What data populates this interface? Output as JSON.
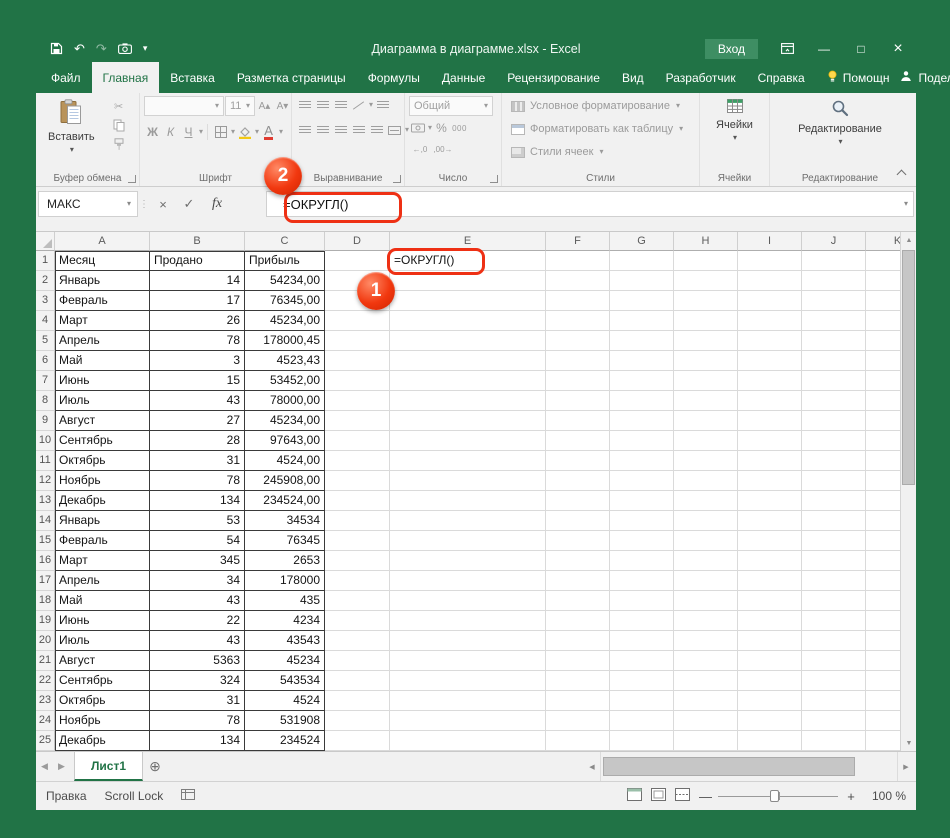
{
  "titlebar": {
    "title": "Диаграмма в диаграмме.xlsx  -  Excel",
    "sign_in": "Вход"
  },
  "icons": {
    "undo": "↶",
    "redo": "↷",
    "dropdown": "▾",
    "minimize": "—",
    "maximize": "□",
    "close": "×",
    "scissors": "✂",
    "check": "✓",
    "cancel": "×",
    "fx": "fx",
    "grip": "⋮",
    "prev_sheet": "◀",
    "next_sheet": "▶",
    "add_sheet": "⊕",
    "up": "▲",
    "down": "▼",
    "left": "◀",
    "right": "▶",
    "percent": "%",
    "thousands": "000",
    "dec_inc": "←,0",
    "dec_dec": ",00→",
    "zoom_out": "—",
    "zoom_in": "+",
    "bold": "Ж",
    "italic": "К",
    "underline": "Ч",
    "grow_font": "А▴",
    "shrink_font": "А▾",
    "font_color_letter": "А"
  },
  "ribbon_tabs": [
    {
      "label": "Файл"
    },
    {
      "label": "Главная",
      "active": true
    },
    {
      "label": "Вставка"
    },
    {
      "label": "Разметка страницы"
    },
    {
      "label": "Формулы"
    },
    {
      "label": "Данные"
    },
    {
      "label": "Рецензирование"
    },
    {
      "label": "Вид"
    },
    {
      "label": "Разработчик"
    },
    {
      "label": "Справка"
    },
    {
      "label": "Помощн",
      "bulb": true
    }
  ],
  "share_label": "Поделиться",
  "ribbon": {
    "paste": "Вставить",
    "font_name": "",
    "font_size": "11",
    "number_format": "Общий",
    "style_buttons": [
      "Условное форматирование",
      "Форматировать как таблицу",
      "Стили ячеек"
    ],
    "cells": "Ячейки",
    "editing": "Редактирование",
    "groups": [
      "Буфер обмена",
      "Шрифт",
      "Выравнивание",
      "Число",
      "Стили",
      "Ячейки",
      "Редактирование"
    ]
  },
  "formula_bar": {
    "name_box": "МАКС",
    "formula": "=ОКРУГЛ()"
  },
  "annotations": {
    "step1": "1",
    "step2": "2",
    "accent": "#ee3014"
  },
  "sheet": {
    "col_headers": [
      "A",
      "B",
      "C",
      "D",
      "E",
      "F",
      "G",
      "H",
      "I",
      "J",
      "K"
    ],
    "e1": "=ОКРУГЛ()",
    "rows": [
      [
        "1",
        "Месяц",
        "Продано",
        "Прибыль"
      ],
      [
        "2",
        "Январь",
        "14",
        "54234,00"
      ],
      [
        "3",
        "Февраль",
        "17",
        "76345,00"
      ],
      [
        "4",
        "Март",
        "26",
        "45234,00"
      ],
      [
        "5",
        "Апрель",
        "78",
        "178000,45"
      ],
      [
        "6",
        "Май",
        "3",
        "4523,43"
      ],
      [
        "7",
        "Июнь",
        "15",
        "53452,00"
      ],
      [
        "8",
        "Июль",
        "43",
        "78000,00"
      ],
      [
        "9",
        "Август",
        "27",
        "45234,00"
      ],
      [
        "10",
        "Сентябрь",
        "28",
        "97643,00"
      ],
      [
        "11",
        "Октябрь",
        "31",
        "4524,00"
      ],
      [
        "12",
        "Ноябрь",
        "78",
        "245908,00"
      ],
      [
        "13",
        "Декабрь",
        "134",
        "234524,00"
      ],
      [
        "14",
        "Январь",
        "53",
        "34534"
      ],
      [
        "15",
        "Февраль",
        "54",
        "76345"
      ],
      [
        "16",
        "Март",
        "345",
        "2653"
      ],
      [
        "17",
        "Апрель",
        "34",
        "178000"
      ],
      [
        "18",
        "Май",
        "43",
        "435"
      ],
      [
        "19",
        "Июнь",
        "22",
        "4234"
      ],
      [
        "20",
        "Июль",
        "43",
        "43543"
      ],
      [
        "21",
        "Август",
        "5363",
        "45234"
      ],
      [
        "22",
        "Сентябрь",
        "324",
        "543534"
      ],
      [
        "23",
        "Октябрь",
        "31",
        "4524"
      ],
      [
        "24",
        "Ноябрь",
        "78",
        "531908"
      ],
      [
        "25",
        "Декабрь",
        "134",
        "234524"
      ]
    ]
  },
  "sheet_tabs": {
    "active": "Лист1"
  },
  "status_bar": {
    "mode": "Правка",
    "scroll_lock": "Scroll Lock",
    "zoom": "100 %"
  }
}
